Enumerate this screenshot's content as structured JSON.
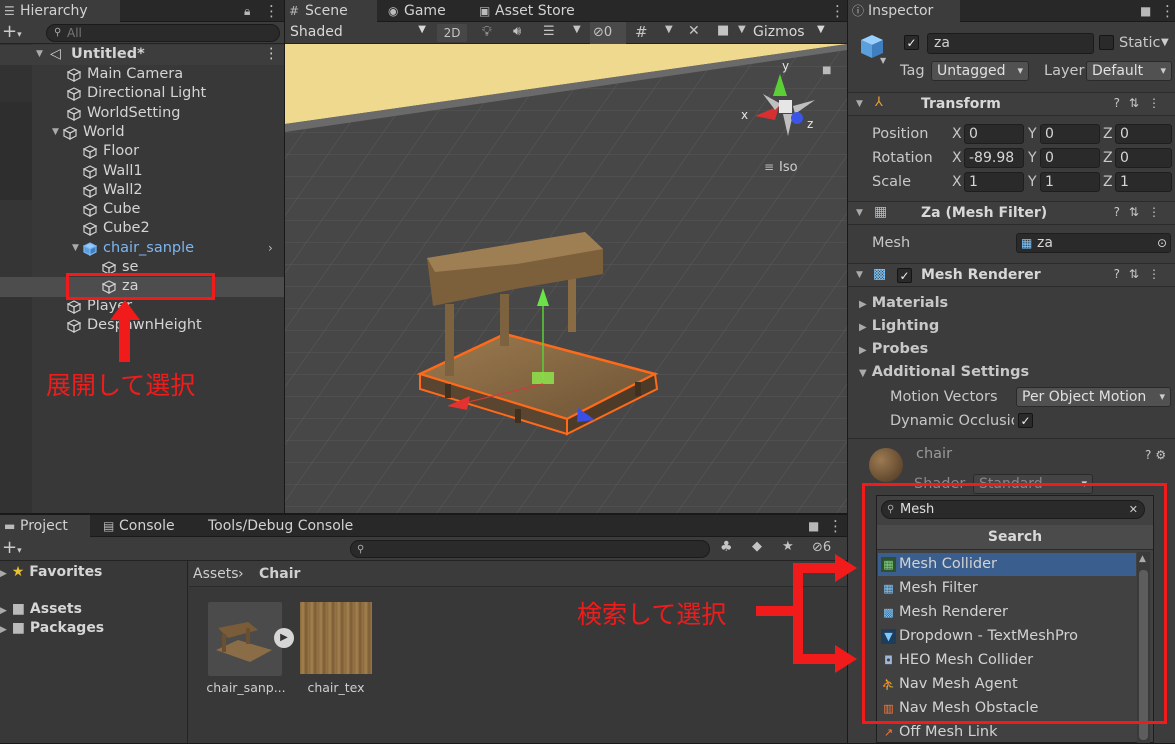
{
  "hierarchy": {
    "tab": "Hierarchy",
    "search_placeholder": "All",
    "scene_name": "Untitled*",
    "items": [
      "Main Camera",
      "Directional Light",
      "WorldSetting",
      "World",
      "Floor",
      "Wall1",
      "Wall2",
      "Cube",
      "Cube2",
      "chair_sanple",
      "se",
      "za",
      "Player",
      "DespawnHeight"
    ]
  },
  "scene": {
    "tabs": [
      "Scene",
      "Game",
      "Asset Store"
    ],
    "shading": "Shaded",
    "mode_2d": "2D",
    "hidden_count": "0",
    "gizmos": "Gizmos",
    "gizmo": {
      "x": "x",
      "y": "y",
      "z": "z",
      "projection": "Iso"
    }
  },
  "project": {
    "tabs": [
      "Project",
      "Console",
      "Tools/Debug Console"
    ],
    "favorites": "Favorites",
    "assets": "Assets",
    "packages": "Packages",
    "breadcrumb": [
      "Assets",
      "Chair"
    ],
    "hidden_count": "6",
    "files": [
      {
        "name": "chair_sanp..."
      },
      {
        "name": "chair_tex"
      }
    ]
  },
  "inspector": {
    "tab": "Inspector",
    "object_name": "za",
    "static_label": "Static",
    "tag_label": "Tag",
    "tag_value": "Untagged",
    "layer_label": "Layer",
    "layer_value": "Default",
    "transform": {
      "title": "Transform",
      "position_label": "Position",
      "rotation_label": "Rotation",
      "scale_label": "Scale",
      "axis_x": "X",
      "axis_y": "Y",
      "axis_z": "Z",
      "position": [
        "0",
        "0",
        "0"
      ],
      "rotation": [
        "-89.98",
        "0",
        "0"
      ],
      "scale": [
        "1",
        "1",
        "1"
      ]
    },
    "mesh_filter": {
      "title": "Za (Mesh Filter)",
      "mesh_label": "Mesh",
      "mesh_value": "za"
    },
    "mesh_renderer": {
      "title": "Mesh Renderer",
      "materials": "Materials",
      "lighting": "Lighting",
      "probes": "Probes",
      "additional": "Additional Settings",
      "motion_vectors_label": "Motion Vectors",
      "motion_vectors_value": "Per Object Motion",
      "dynamic_occlusion_label": "Dynamic Occlusion"
    },
    "material": {
      "name": "chair",
      "shader_label": "Shader",
      "shader_value": "Standard"
    }
  },
  "component_popup": {
    "search_value": "Mesh",
    "header": "Search",
    "items": [
      "Mesh Collider",
      "Mesh Filter",
      "Mesh Renderer",
      "Dropdown - TextMeshPro",
      "HEO Mesh Collider",
      "Nav Mesh Agent",
      "Nav Mesh Obstacle",
      "Off Mesh Link"
    ]
  },
  "annotations": {
    "expand_select": "展開して選択",
    "search_select": "検索して選択"
  },
  "colors": {
    "accent_red": "#f21b1b",
    "selection_blue": "#3a5f8e",
    "prefab_blue": "#7bb6f2"
  }
}
